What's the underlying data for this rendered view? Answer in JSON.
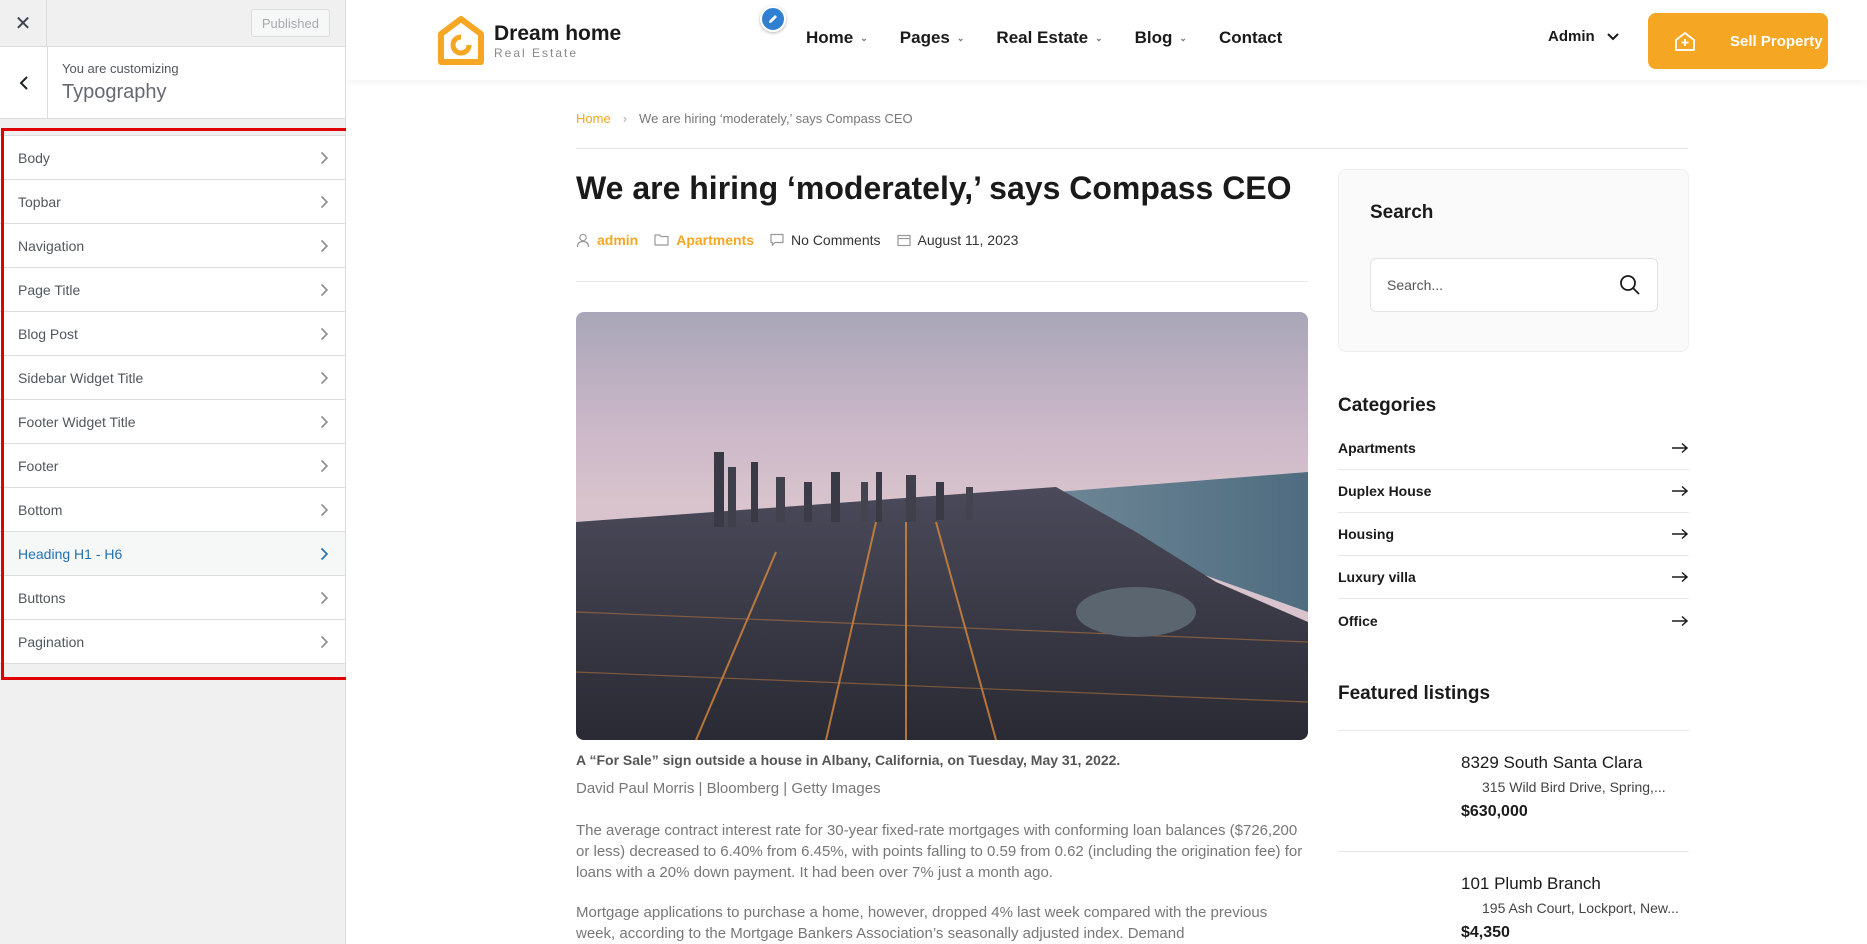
{
  "customizer": {
    "close_icon": "close-icon",
    "publish_label": "Published",
    "context_label": "You are customizing",
    "section_title": "Typography",
    "items": [
      {
        "label": "Body",
        "active": false
      },
      {
        "label": "Topbar",
        "active": false
      },
      {
        "label": "Navigation",
        "active": false
      },
      {
        "label": "Page Title",
        "active": false
      },
      {
        "label": "Blog Post",
        "active": false
      },
      {
        "label": "Sidebar Widget Title",
        "active": false
      },
      {
        "label": "Footer Widget Title",
        "active": false
      },
      {
        "label": "Footer",
        "active": false
      },
      {
        "label": "Bottom",
        "active": false
      },
      {
        "label": "Heading H1 - H6",
        "active": true
      },
      {
        "label": "Buttons",
        "active": false
      },
      {
        "label": "Pagination",
        "active": false
      }
    ],
    "highlight_color": "#e00000"
  },
  "site": {
    "logo": {
      "title": "Dream home",
      "subtitle": "Real Estate"
    },
    "nav": [
      {
        "label": "Home",
        "has_dropdown": true
      },
      {
        "label": "Pages",
        "has_dropdown": true
      },
      {
        "label": "Real Estate",
        "has_dropdown": true
      },
      {
        "label": "Blog",
        "has_dropdown": true
      },
      {
        "label": "Contact",
        "has_dropdown": false
      }
    ],
    "admin_label": "Admin",
    "sell_button": "Sell Property",
    "accent_color": "#f5a623",
    "breadcrumb": {
      "home": "Home",
      "separator": "›",
      "current": "We are hiring ‘moderately,’ says Compass CEO"
    },
    "post": {
      "title": "We are hiring ‘moderately,’ says Compass CEO",
      "author": "admin",
      "category": "Apartments",
      "comments": "No Comments",
      "date": "August 11, 2023",
      "caption": "A “For Sale” sign outside a house in Albany, California, on Tuesday, May 31, 2022.",
      "credit": "David Paul Morris | Bloomberg | Getty Images",
      "paragraph1": "The average contract interest rate for 30-year fixed-rate mortgages with conforming loan balances ($726,200 or less) decreased to 6.40% from 6.45%, with points falling to 0.59 from 0.62 (including the origination fee) for loans with a 20% down payment. It had been over 7% just a month ago.",
      "paragraph2": "Mortgage applications to purchase a home, however, dropped 4% last week compared with the previous week, according to the Mortgage Bankers Association’s seasonally adjusted index. Demand"
    },
    "sidebar": {
      "search_title": "Search",
      "search_placeholder": "Search...",
      "categories_title": "Categories",
      "categories": [
        "Apartments",
        "Duplex House",
        "Housing",
        "Luxury villa",
        "Office"
      ],
      "featured_title": "Featured listings",
      "listings": [
        {
          "name": "8329 South Santa Clara",
          "address": "315 Wild Bird Drive, Spring,...",
          "price": "$630,000"
        },
        {
          "name": "101 Plumb Branch",
          "address": "195 Ash Court, Lockport, New...",
          "price": "$4,350"
        }
      ]
    }
  }
}
